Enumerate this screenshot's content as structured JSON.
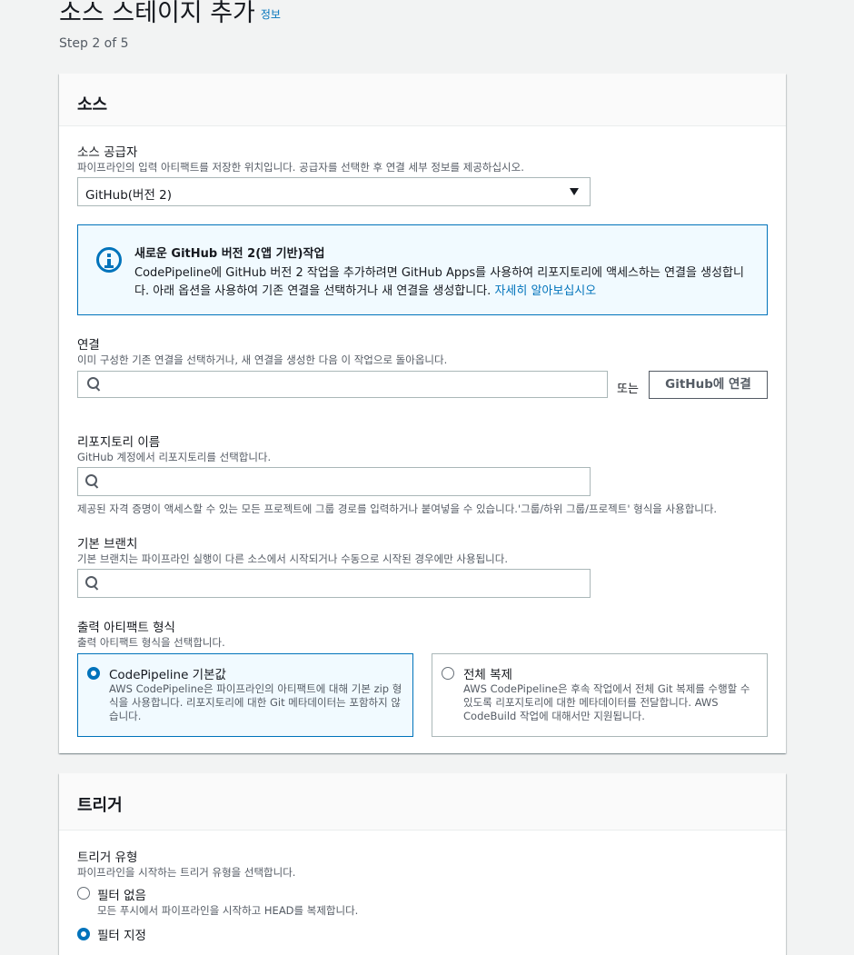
{
  "header": {
    "title": "소스 스테이지 추가",
    "info_link": "정보",
    "step": "Step 2 of 5"
  },
  "source_panel": {
    "title": "소스",
    "provider": {
      "label": "소스 공급자",
      "description": "파이프라인의 입력 아티팩트를 저장한 위치입니다. 공급자를 선택한 후 연결 세부 정보를 제공하십시오.",
      "selected": "GitHub(버전 2)"
    },
    "alert": {
      "title": "새로운 GitHub 버전 2(앱 기반)작업",
      "text": "CodePipeline에 GitHub 버전 2 작업을 추가하려면 GitHub Apps를 사용하여 리포지토리에 액세스하는 연결을 생성합니다. 아래 옵션을 사용하여 기존 연결을 선택하거나 새 연결을 생성합니다. ",
      "link": "자세히 알아보십시오"
    },
    "connection": {
      "label": "연결",
      "description": "이미 구성한 기존 연결을 선택하거나, 새 연결을 생성한 다음 이 작업으로 돌아옵니다.",
      "value": "",
      "or_text": "또는",
      "connect_button": "GitHub에 연결"
    },
    "repository": {
      "label": "리포지토리 이름",
      "description": "GitHub 계정에서 리포지토리를 선택합니다.",
      "value": "",
      "hint": "제공된 자격 증명이 액세스할 수 있는 모든 프로젝트에 그룹 경로를 입력하거나 붙여넣을 수 있습니다.'그룹/하위 그룹/프로젝트' 형식을 사용합니다."
    },
    "branch": {
      "label": "기본 브랜치",
      "description": "기본 브랜치는 파이프라인 실행이 다른 소스에서 시작되거나 수동으로 시작된 경우에만 사용됩니다.",
      "value": ""
    },
    "artifact_format": {
      "label": "출력 아티팩트 형식",
      "description": "출력 아티팩트 형식을 선택합니다.",
      "options": [
        {
          "title": "CodePipeline 기본값",
          "description": "AWS CodePipeline은 파이프라인의 아티팩트에 대해 기본 zip 형식을 사용합니다. 리포지토리에 대한 Git 메타데이터는 포함하지 않습니다.",
          "selected": true
        },
        {
          "title": "전체 복제",
          "description": "AWS CodePipeline은 후속 작업에서 전체 Git 복제를 수행할 수 있도록 리포지토리에 대한 메타데이터를 전달합니다. AWS CodeBuild 작업에 대해서만 지원됩니다.",
          "selected": false
        }
      ]
    }
  },
  "trigger_panel": {
    "title": "트리거",
    "trigger_type": {
      "label": "트리거 유형",
      "description": "파이프라인을 시작하는 트리거 유형을 선택합니다.",
      "options": [
        {
          "label": "필터 없음",
          "description": "모든 푸시에서 파이프라인을 시작하고 HEAD를 복제합니다.",
          "selected": false
        },
        {
          "label": "필터 지정",
          "selected": true
        }
      ]
    }
  },
  "colors": {
    "accent": "#0073bb",
    "background": "#f2f3f3",
    "selected_tile_bg": "#f1faff"
  }
}
